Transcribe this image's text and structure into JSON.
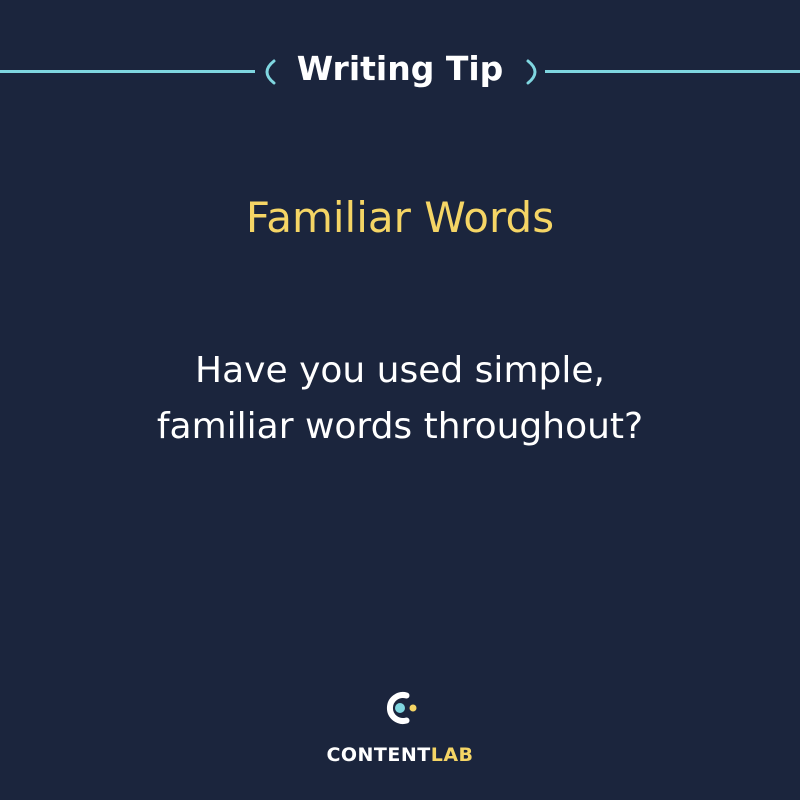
{
  "header": {
    "title": "Writing Tip"
  },
  "tip": {
    "heading": "Familiar Words",
    "body_lines": [
      "Have you used simple,",
      "familiar words throughout?"
    ]
  },
  "brand": {
    "name_part1": "CONTENT",
    "name_part2": "LAB",
    "logo_icon": "contentlab-c-icon"
  },
  "colors": {
    "background": "#1b253d",
    "accent_line": "#7fd6e0",
    "heading": "#f5d565",
    "text": "#ffffff"
  }
}
